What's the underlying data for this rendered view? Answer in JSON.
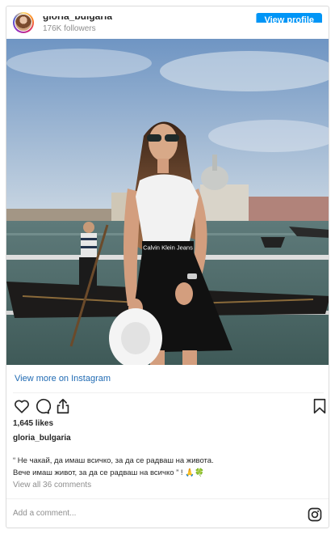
{
  "header": {
    "username": "gloria_bulgaria",
    "followers": "176K followers",
    "view_profile": "View profile"
  },
  "post": {
    "view_more": "View more on Instagram",
    "likes": "1,645 likes",
    "owner": "gloria_bulgaria",
    "caption_line1": "“ Не чакай, да имаш всичко, за да се радваш на живота.",
    "caption_line2": "Вече имаш живот, за да се радваш на всичко ” ! 🙏🍀",
    "view_comments": "View all 36 comments",
    "add_comment_placeholder": "Add a comment..."
  },
  "photo": {
    "belt_text": "Calvin Klein Jeans"
  },
  "icons": [
    "heart-icon",
    "comment-icon",
    "share-icon",
    "bookmark-icon",
    "instagram-icon"
  ],
  "colors": {
    "accent": "#0095f6",
    "link": "#1f6ab3",
    "muted": "#8e8e8e"
  }
}
